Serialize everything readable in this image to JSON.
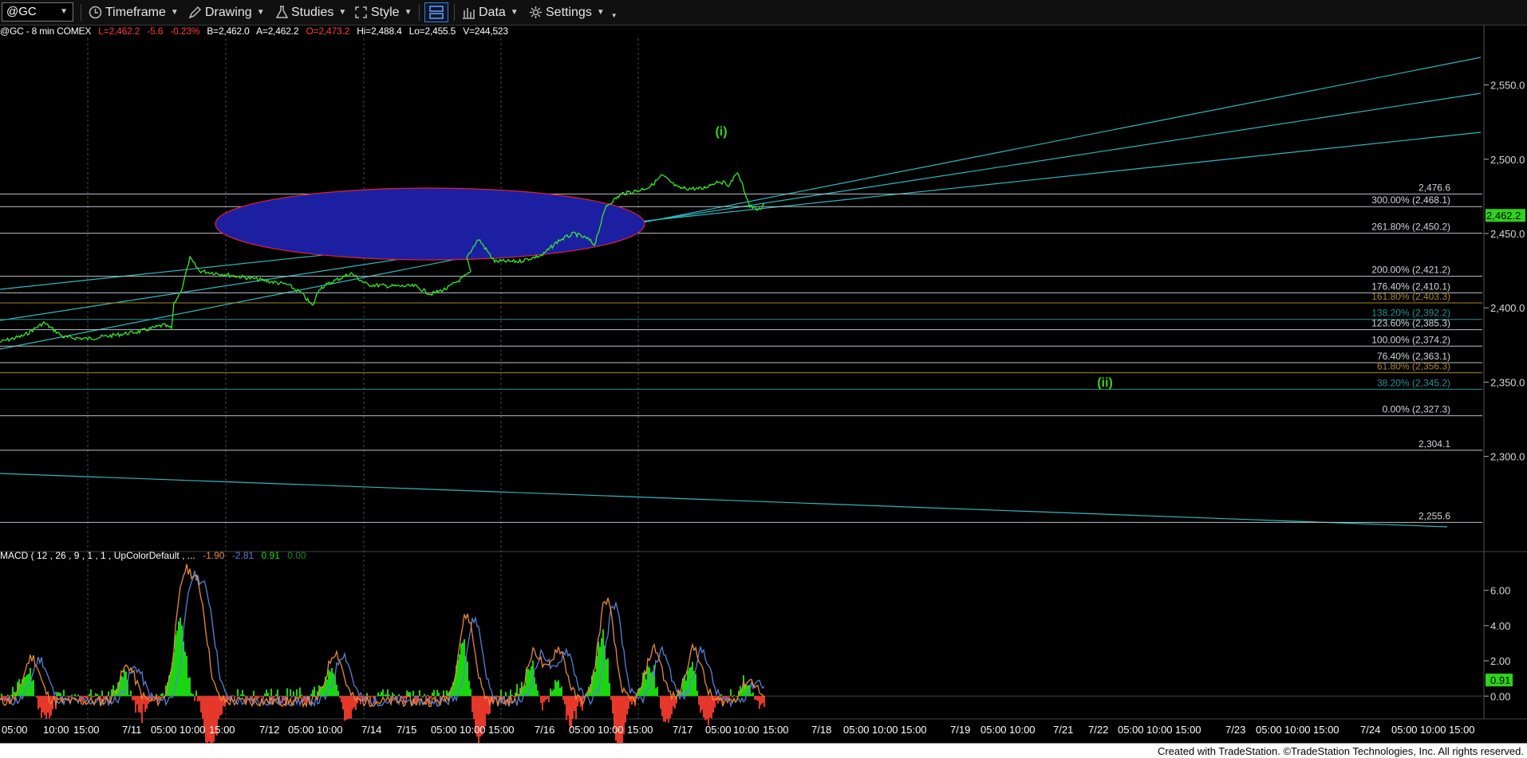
{
  "toolbar": {
    "symbol": "@GC",
    "items": [
      {
        "label": "Timeframe",
        "icon": "clock-icon"
      },
      {
        "label": "Drawing",
        "icon": "pencil-icon"
      },
      {
        "label": "Studies",
        "icon": "flask-icon"
      },
      {
        "label": "Style",
        "icon": "style-icon"
      },
      {
        "label": "Data",
        "icon": "bar-chart-icon"
      },
      {
        "label": "Settings",
        "icon": "gear-icon"
      }
    ]
  },
  "status": {
    "symbol_info": "@GC - 8 min  COMEX",
    "last": "L=2,462.2",
    "change": "-5.6",
    "change_pct": "-0.23%",
    "bid": "B=2,462.0",
    "ask": "A=2,462.2",
    "open": "O=2,473.2",
    "high": "Hi=2,488.4",
    "low": "Lo=2,455.5",
    "volume": "V=244,523"
  },
  "colors": {
    "price": "#35e82a",
    "channel": "#2fb8bd",
    "level": "#b9c3c9",
    "ellipse_fill": "#1d1fa3",
    "ellipse_stroke": "#e0203a",
    "down": "#e6372b",
    "up": "#19d60f",
    "macd_line": "#e98a3c",
    "signal_line": "#5a7fd6"
  },
  "price_axis": {
    "ticks": [
      "2,550.0",
      "2,500.0",
      "2,450.0",
      "2,400.0",
      "2,350.0",
      "2,300.0"
    ],
    "tick_values": [
      2550,
      2500,
      2450,
      2400,
      2350,
      2300
    ],
    "range": [
      2237,
      2590
    ],
    "last_price_label": "2,462.2"
  },
  "time_axis": {
    "labels": [
      "05:00",
      "10:00",
      "15:00",
      "7/11",
      "05:00",
      "10:00",
      "15:00",
      "7/12",
      "05:00",
      "10:00",
      "7/14",
      "7/15",
      "05:00",
      "10:00",
      "15:00",
      "7/16",
      "05:00",
      "10:00",
      "15:00",
      "7/17",
      "05:00",
      "10:00",
      "15:00",
      "7/18",
      "05:00",
      "10:00",
      "15:00",
      "7/19",
      "05:00",
      "10:00",
      "7/21",
      "7/22",
      "05:00",
      "10:00",
      "15:00",
      "7/23",
      "05:00",
      "10:00",
      "15:00",
      "7/24",
      "05:00",
      "10:00",
      "15:00"
    ]
  },
  "fib_levels": [
    {
      "label": "2,476.6",
      "value": 2476.6,
      "color": "#cfd6da"
    },
    {
      "label": "300.00% (2,468.1)",
      "value": 2468.1,
      "color": "#cfd6da"
    },
    {
      "label": "261.80% (2,450.2)",
      "value": 2450.2,
      "color": "#cfd6da"
    },
    {
      "label": "200.00% (2,421.2)",
      "value": 2421.2,
      "color": "#cfd6da"
    },
    {
      "label": "176.40% (2,410.1)",
      "value": 2410.1,
      "color": "#cfd6da"
    },
    {
      "label": "161.80% (2,403.3)",
      "value": 2403.3,
      "color": "#a8862e"
    },
    {
      "label": "138.20% (2,392.2)",
      "value": 2392.2,
      "color": "#2b8f95"
    },
    {
      "label": "123.60% (2,385.3)",
      "value": 2385.3,
      "color": "#cfd6da"
    },
    {
      "label": "100.00% (2,374.2)",
      "value": 2374.2,
      "color": "#cfd6da"
    },
    {
      "label": "76.40% (2,363.1)",
      "value": 2363.1,
      "color": "#cfd6da"
    },
    {
      "label": "61.80% (2,356.3)",
      "value": 2356.3,
      "color": "#a8862e"
    },
    {
      "label": "38.20% (2,345.2)",
      "value": 2345.2,
      "color": "#2b8f95"
    },
    {
      "label": "0.00% (2,327.3)",
      "value": 2327.3,
      "color": "#cfd6da"
    },
    {
      "label": "2,304.1",
      "value": 2304.1,
      "color": "#cfd6da"
    },
    {
      "label": "2,255.6",
      "value": 2255.6,
      "color": "#cfd6da"
    }
  ],
  "wave_labels": [
    "(i)",
    "(ii)"
  ],
  "macd": {
    "legend_name": "MACD ( 12 , 26 , 9 , 1 , 1 , UpColorDefault , ...",
    "value_macd": "-1.90",
    "value_avg": "-2.81",
    "value_diff": "0.91",
    "value_zero": "0.00",
    "ticks": [
      "6.00",
      "4.00",
      "2.00",
      "0.00"
    ],
    "tick_values": [
      6,
      4,
      2,
      0
    ],
    "range": [
      -1.3,
      7.3
    ],
    "last_label": "0.91"
  },
  "footer": "Created with TradeStation. ©TradeStation Technologies, Inc. All rights reserved."
}
